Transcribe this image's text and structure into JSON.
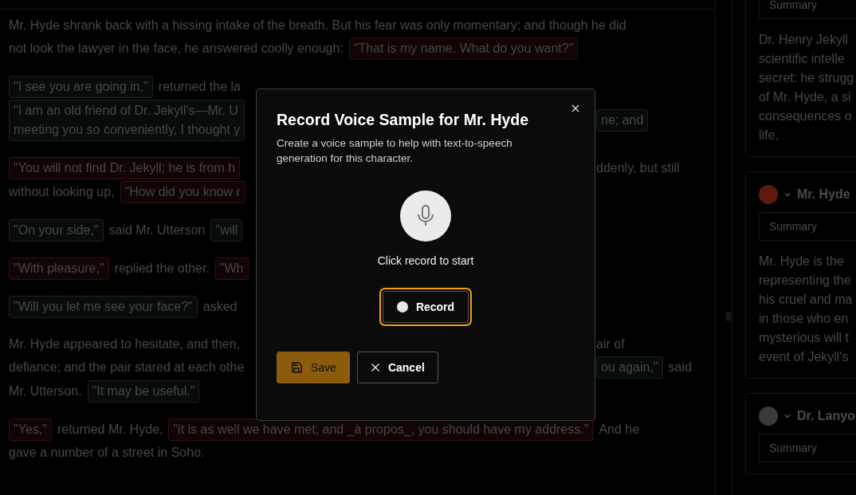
{
  "story": {
    "paragraphs": [
      {
        "lines": [
          {
            "kind": "open",
            "left": [
              {
                "kind": "narration",
                "text": "Mr. Hyde shrank back with a hissing intake of the breath. But his fear was only momentary; and though he did"
              }
            ]
          },
          {
            "kind": "open",
            "left": [
              {
                "kind": "narration",
                "text": "not look the lawyer in the face, he answered coolly enough:"
              },
              {
                "kind": "quote",
                "color": "#3a0e0e",
                "text": "\"That is my name. What do you want?\""
              }
            ]
          }
        ]
      },
      {
        "lines": [
          {
            "kind": "covered",
            "left": [
              {
                "kind": "quote",
                "color": "#1b2326",
                "text": "\"I see you are going in,\""
              },
              {
                "kind": "narration",
                "text": "returned the la"
              }
            ]
          },
          {
            "kind": "covered",
            "left": [
              {
                "kind": "quote",
                "color": "#1b2326",
                "text": "\"I am an old friend of Dr. Jekyll's—Mr. U\nmeeting you so conveniently, I thought y"
              }
            ],
            "right": [
              {
                "kind": "quote",
                "color": "#1b2326",
                "text": "ne; and"
              }
            ]
          }
        ]
      },
      {
        "lines": [
          {
            "kind": "covered",
            "left": [
              {
                "kind": "quote",
                "color": "#3a0e0e",
                "text": "\"You will not find Dr. Jekyll; he is from h"
              }
            ],
            "right": [
              {
                "kind": "narration",
                "text": "ddenly, but still"
              }
            ]
          },
          {
            "kind": "covered",
            "left": [
              {
                "kind": "narration",
                "text": "without looking up,"
              },
              {
                "kind": "quote",
                "color": "#3a0e0e",
                "text": "\"How did you know r"
              }
            ]
          }
        ]
      },
      {
        "lines": [
          {
            "kind": "covered",
            "left": [
              {
                "kind": "quote",
                "color": "#1b2326",
                "text": "\"On your side,\""
              },
              {
                "kind": "narration",
                "text": "said Mr. Utterson"
              },
              {
                "kind": "quote",
                "color": "#1b2326",
                "text": "\"will"
              }
            ]
          }
        ]
      },
      {
        "lines": [
          {
            "kind": "covered",
            "left": [
              {
                "kind": "quote",
                "color": "#3a0e0e",
                "text": "\"With pleasure,\""
              },
              {
                "kind": "narration",
                "text": "replied the other."
              },
              {
                "kind": "quote",
                "color": "#3a0e0e",
                "text": "\"Wh"
              }
            ]
          }
        ]
      },
      {
        "lines": [
          {
            "kind": "covered",
            "left": [
              {
                "kind": "quote",
                "color": "#1b2326",
                "text": "\"Will you let me see your face?\""
              },
              {
                "kind": "narration",
                "text": "asked"
              }
            ]
          }
        ]
      },
      {
        "lines": [
          {
            "kind": "covered",
            "left": [
              {
                "kind": "narration",
                "text": "Mr. Hyde appeared to hesitate, and then,"
              }
            ],
            "right": [
              {
                "kind": "narration",
                "text": "air of"
              }
            ]
          },
          {
            "kind": "covered",
            "left": [
              {
                "kind": "narration",
                "text": "defiance; and the pair stared at each othe"
              }
            ],
            "right": [
              {
                "kind": "quote",
                "color": "#1b2326",
                "text": "ou again,\""
              },
              {
                "kind": "narration",
                "text": "said"
              }
            ]
          },
          {
            "kind": "open",
            "left": [
              {
                "kind": "narration",
                "text": "Mr. Utterson."
              },
              {
                "kind": "quote",
                "color": "#1b2326",
                "text": "\"It may be useful.\""
              }
            ]
          }
        ]
      },
      {
        "lines": [
          {
            "kind": "open",
            "left": [
              {
                "kind": "quote",
                "color": "#3a0e0e",
                "text": "\"Yes,\""
              },
              {
                "kind": "narration",
                "text": "returned Mr. Hyde,"
              },
              {
                "kind": "quote",
                "color": "#3a0e0e",
                "text": "\"it is as well we have met; and _à propos_, you should have my address.\""
              },
              {
                "kind": "narration",
                "text": "And he"
              }
            ]
          },
          {
            "kind": "open",
            "left": [
              {
                "kind": "narration",
                "text": "gave a number of a street in Soho."
              }
            ]
          }
        ]
      }
    ]
  },
  "sidebar": {
    "cards": [
      {
        "select": "Summary",
        "summary_lines": [
          "Dr. Henry Jekyll",
          "scientific intelle",
          "secret: he strugg",
          "of Mr. Hyde, a si",
          "consequences o",
          "life."
        ]
      },
      {
        "name": "Mr. Hyde",
        "color": "#5e1a0c",
        "select": "Summary",
        "summary_lines": [
          "Mr. Hyde is the",
          "representing the",
          "his cruel and ma",
          "in those who en",
          "mysterious will t",
          "event of Jekyll's"
        ]
      },
      {
        "name": "Dr. Lanyo",
        "color": "#3a3a3a",
        "select": "Summary"
      }
    ]
  },
  "dialog": {
    "title": "Record Voice Sample for Mr. Hyde",
    "description": "Create a voice sample to help with text-to-speech generation for this character.",
    "status": "Click record to start",
    "record_button": {
      "label": "Record",
      "focused": true
    },
    "buttons": [
      {
        "kind": "save",
        "label": "Save"
      },
      {
        "kind": "cancel",
        "label": "Cancel"
      }
    ]
  }
}
